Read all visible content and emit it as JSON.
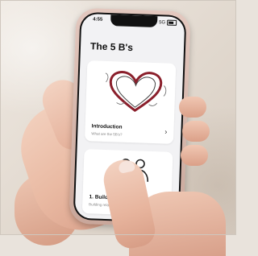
{
  "status_bar": {
    "time": "4:55",
    "network": "5G"
  },
  "page_title": "The 5 B's",
  "cards": [
    {
      "title": "Introduction",
      "subtitle": "What are the 5B's?"
    },
    {
      "title": "1. Build",
      "subtitle": "Building relationships"
    }
  ],
  "colors": {
    "accent_heart": "#8a1f2b",
    "screen_bg": "#f2f2f4",
    "phone_case": "#d8bcb2"
  },
  "icons": [
    "heart-illustration-icon",
    "people-illustration-icon",
    "chevron-right-icon",
    "battery-icon"
  ]
}
